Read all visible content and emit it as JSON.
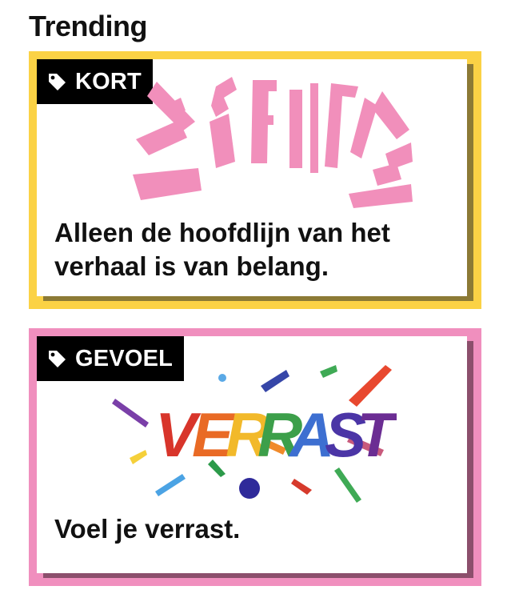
{
  "section": {
    "title": "Trending"
  },
  "cards": [
    {
      "tag_label": "KORT",
      "tag_icon": "tag-icon",
      "art_word": "SEHITS",
      "accent_color": "#fbd245",
      "art_color": "#f18fbb",
      "text": "Alleen de hoofdlijn van het verhaal is van belang."
    },
    {
      "tag_label": "GEVOEL",
      "tag_icon": "tag-icon",
      "art_word": "VERRAST",
      "accent_color": "#f08fbe",
      "text": "Voel je verrast."
    }
  ]
}
